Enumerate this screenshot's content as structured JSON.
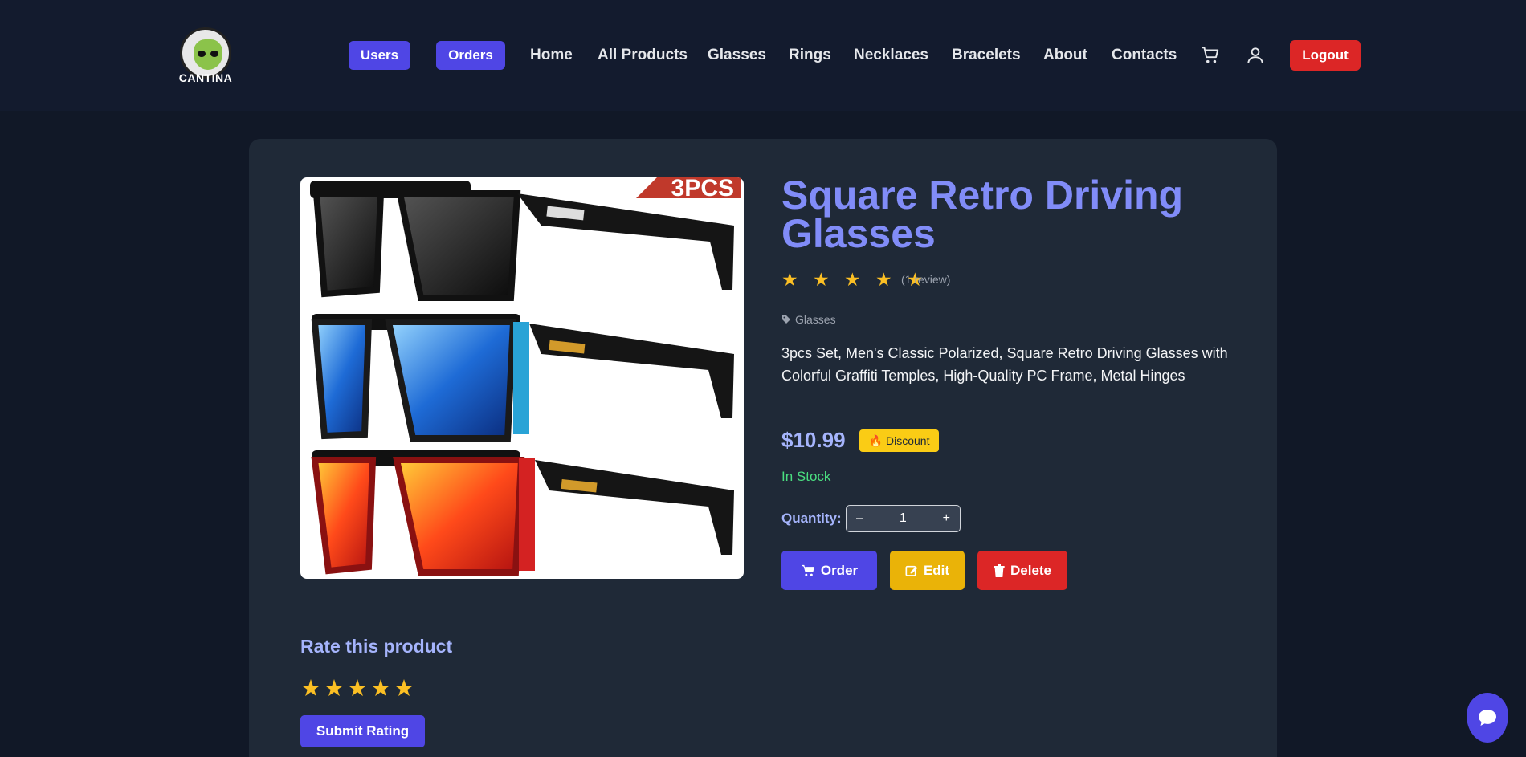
{
  "header": {
    "logo_text": "CANTINA",
    "nav_pills": [
      {
        "label": "Users"
      },
      {
        "label": "Orders"
      }
    ],
    "nav_links": [
      "Home",
      "All Products",
      "Glasses",
      "Rings",
      "Necklaces",
      "Bracelets",
      "About",
      "Contacts"
    ],
    "logout_label": "Logout",
    "icons": [
      "cart-icon",
      "user-icon"
    ]
  },
  "product": {
    "image_badge": "3PCS",
    "title": "Square Retro Driving Glasses",
    "stars": "★ ★ ★ ★ ★",
    "rating": 5,
    "review_count": "(1 review)",
    "category": "Glasses",
    "description": "3pcs Set, Men's Classic Polarized, Square Retro Driving Glasses with Colorful Graffiti Temples, High-Quality PC Frame, Metal Hinges",
    "price": "$10.99",
    "discount_label": "Discount",
    "stock_status": "In Stock",
    "quantity_label": "Quantity:",
    "quantity_value": "1",
    "qty_minus": "–",
    "qty_plus": "+",
    "buttons": {
      "order": "Order",
      "edit": "Edit",
      "delete": "Delete"
    }
  },
  "rating_section": {
    "title": "Rate this product",
    "stars": "★★★★★",
    "submit_label": "Submit Rating"
  },
  "colors": {
    "accent": "#4f46e5",
    "title": "#818cf8",
    "star": "#fbbf24",
    "danger": "#dc2626",
    "warning": "#eab308",
    "success": "#4ade80"
  }
}
